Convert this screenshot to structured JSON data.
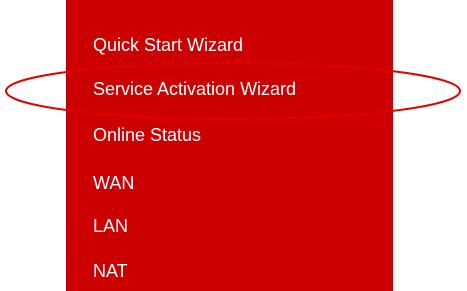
{
  "menu": {
    "items": [
      {
        "label": "Quick Start Wizard"
      },
      {
        "label": "Service Activation Wizard"
      },
      {
        "label": "Online Status"
      },
      {
        "label": "WAN"
      },
      {
        "label": "LAN"
      },
      {
        "label": "NAT"
      }
    ]
  },
  "colors": {
    "menu_background": "#cc0000",
    "menu_text": "#ffffff",
    "highlight_ellipse": "#e00000"
  },
  "annotation": {
    "highlighted_item": "Service Activation Wizard"
  }
}
